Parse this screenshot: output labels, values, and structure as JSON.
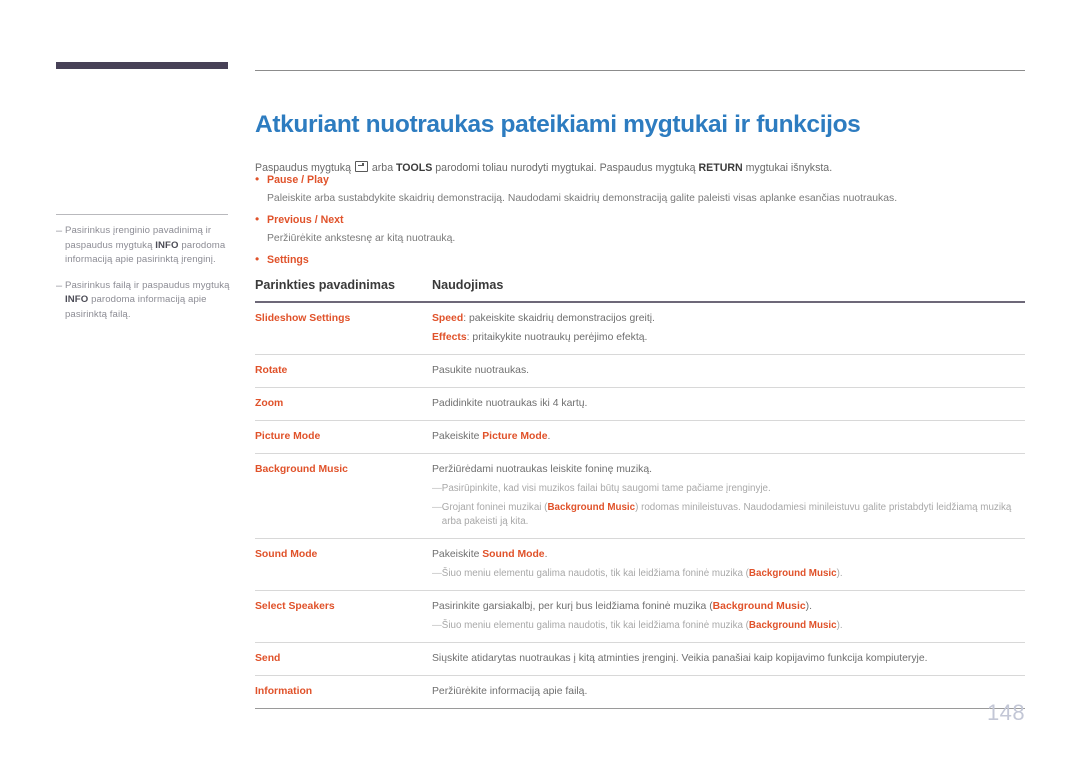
{
  "document": {
    "page_number": "148",
    "title": "Atkuriant nuotraukas pateikiami mygtukai ir funkcijos",
    "intro": {
      "before_icon": "Paspaudus mygtuką ",
      "icon": "enter-key-icon",
      "after_icon": " arba ",
      "bold1": "TOOLS",
      "middle": " parodomi toliau nurodyti mygtukai. Paspaudus mygtuką ",
      "bold2": "RETURN",
      "tail": " mygtukai išnyksta."
    }
  },
  "sidebar": {
    "notes": [
      {
        "dash": "–",
        "before": "Pasirinkus įrenginio pavadinimą ir paspaudus mygtuką ",
        "bold": "INFO",
        "after": " parodoma informaciją apie pasirinktą įrenginį."
      },
      {
        "dash": "–",
        "before": "Pasirinkus failą ir paspaudus mygtuką ",
        "bold": "INFO",
        "after": " parodoma informaciją apie pasirinktą failą."
      }
    ]
  },
  "bullets": [
    {
      "marker": "•",
      "title": "Pause / Play",
      "description": "Paleiskite arba sustabdykite skaidrių demonstraciją. Naudodami skaidrių demonstraciją galite paleisti visas aplanke esančias nuotraukas."
    },
    {
      "marker": "•",
      "title": "Previous / Next",
      "description": "Peržiūrėkite ankstesnę ar kitą nuotrauką."
    },
    {
      "marker": "•",
      "title": "Settings",
      "description": ""
    }
  ],
  "table": {
    "headers": {
      "name": "Parinkties pavadinimas",
      "usage": "Naudojimas"
    },
    "rows": [
      {
        "name": "Slideshow Settings",
        "paragraphs": [
          {
            "accent": "Speed",
            "text": ": pakeiskite skaidrių demonstracijos greitį."
          },
          {
            "accent": "Effects",
            "text": ": pritaikykite nuotraukų perėjimo efektą."
          }
        ],
        "subnotes": []
      },
      {
        "name": "Rotate",
        "paragraphs": [
          {
            "accent": "",
            "text": "Pasukite nuotraukas."
          }
        ],
        "subnotes": []
      },
      {
        "name": "Zoom",
        "paragraphs": [
          {
            "accent": "",
            "text": "Padidinkite nuotraukas iki 4 kartų."
          }
        ],
        "subnotes": []
      },
      {
        "name": "Picture Mode",
        "paragraphs": [
          {
            "accent": "",
            "text": "Pakeiskite ",
            "accent_tail": "Picture Mode",
            "tail": "."
          }
        ],
        "subnotes": []
      },
      {
        "name": "Background Music",
        "paragraphs": [
          {
            "accent": "",
            "text": "Peržiūrėdami nuotraukas leiskite foninę muziką."
          }
        ],
        "subnotes": [
          {
            "dash": "—",
            "before": "Pasirūpinkite, kad visi muzikos failai būtų saugomi tame pačiame įrenginyje.",
            "accent": "",
            "after": ""
          },
          {
            "dash": "—",
            "before": "Grojant foninei muzikai (",
            "accent": "Background Music",
            "after": ") rodomas minileistuvas. Naudodamiesi minileistuvu galite pristabdyti leidžiamą muziką arba pakeisti ją kita."
          }
        ]
      },
      {
        "name": "Sound Mode",
        "paragraphs": [
          {
            "accent": "",
            "text": "Pakeiskite ",
            "accent_tail": "Sound Mode",
            "tail": "."
          }
        ],
        "subnotes": [
          {
            "dash": "—",
            "before": "Šiuo meniu elementu galima naudotis, tik kai leidžiama foninė muzika (",
            "accent": "Background Music",
            "after": ")."
          }
        ]
      },
      {
        "name": "Select Speakers",
        "paragraphs": [
          {
            "accent": "",
            "text": "Pasirinkite garsiakalbį, per kurį bus leidžiama foninė muzika (",
            "accent_tail": "Background Music",
            "tail": ")."
          }
        ],
        "subnotes": [
          {
            "dash": "—",
            "before": "Šiuo meniu elementu galima naudotis, tik kai leidžiama foninė muzika (",
            "accent": "Background Music",
            "after": ")."
          }
        ]
      },
      {
        "name": "Send",
        "paragraphs": [
          {
            "accent": "",
            "text": "Siųskite atidarytas nuotraukas į kitą atminties įrenginį. Veikia panašiai kaip kopijavimo funkcija kompiuteryje."
          }
        ],
        "subnotes": []
      },
      {
        "name": "Information",
        "paragraphs": [
          {
            "accent": "",
            "text": "Peržiūrėkite informaciją apie failą."
          }
        ],
        "subnotes": []
      }
    ]
  },
  "colors": {
    "accent_orange": "#e0522a",
    "title_blue": "#2d7cc0",
    "rail_dark": "#474157",
    "page_number_gray": "#c3c7d6"
  }
}
